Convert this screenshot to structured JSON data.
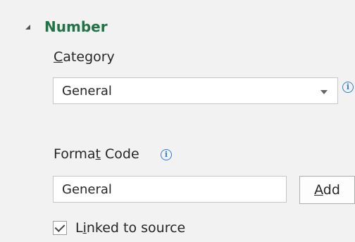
{
  "section": {
    "title": "Number"
  },
  "category": {
    "label_pre": "",
    "label_key": "C",
    "label_post": "ategory",
    "selected": "General"
  },
  "format_code": {
    "label_pre": "Forma",
    "label_key": "t",
    "label_post": " Code",
    "value": "General",
    "add_pre": "",
    "add_key": "A",
    "add_post": "dd"
  },
  "linked": {
    "label_pre": "L",
    "label_key": "i",
    "label_post": "nked to source",
    "checked": true
  },
  "icons": {
    "info": "info-icon",
    "collapse": "collapse-triangle-icon",
    "dropdown": "chevron-down-icon",
    "check": "checkmark-icon"
  },
  "colors": {
    "section_title": "#217346",
    "info": "#2f7ed8"
  }
}
